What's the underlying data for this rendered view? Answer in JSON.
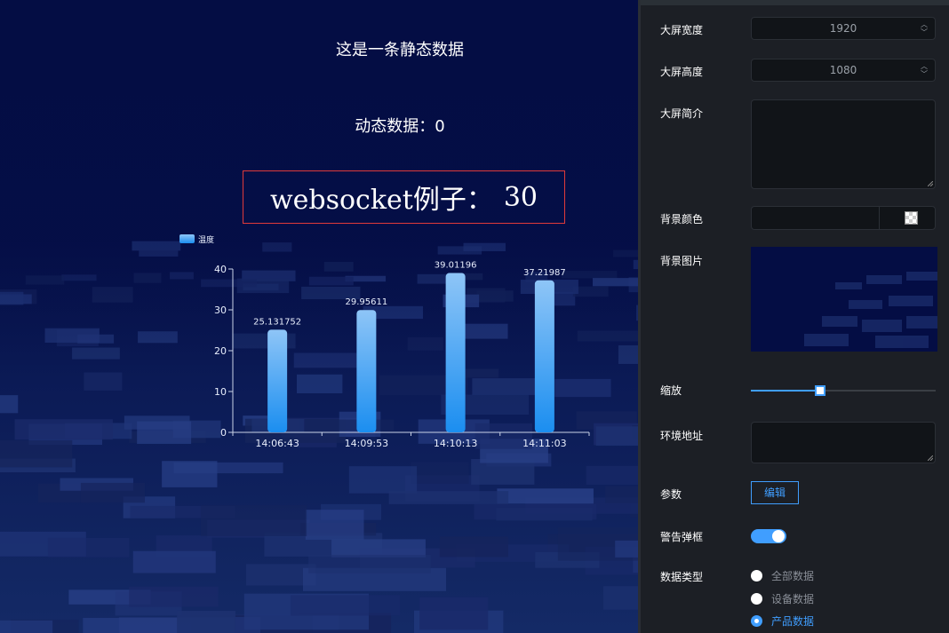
{
  "canvas": {
    "static_text": "这是一条静态数据",
    "dynamic_label": "动态数据：",
    "dynamic_value": "0",
    "ws_label": "websocket例子：",
    "ws_value": "30"
  },
  "chart_data": {
    "type": "bar",
    "legend": [
      "温度"
    ],
    "categories": [
      "14:06:43",
      "14:09:53",
      "14:10:13",
      "14:11:03"
    ],
    "series": [
      {
        "name": "温度",
        "values": [
          25.131752,
          29.95611,
          39.01196,
          37.21987
        ]
      }
    ],
    "value_labels": [
      "25.131752",
      "29.95611",
      "39.01196",
      "37.21987"
    ],
    "ylim": [
      0,
      40
    ],
    "yticks": [
      0,
      10,
      20,
      30,
      40
    ],
    "colors": {
      "bar_top": "#8ec5f7",
      "bar_bottom": "#1b8ef0",
      "axis": "#c9d2e6",
      "text": "#e8eefc"
    }
  },
  "panel": {
    "width": {
      "label": "大屏宽度",
      "value": "1920"
    },
    "height": {
      "label": "大屏高度",
      "value": "1080"
    },
    "intro": {
      "label": "大屏简介",
      "value": ""
    },
    "bg_color": {
      "label": "背景颜色",
      "value": ""
    },
    "bg_image": {
      "label": "背景图片"
    },
    "scale": {
      "label": "缩放",
      "value_fraction": 0.37
    },
    "env_url": {
      "label": "环境地址",
      "value": ""
    },
    "params": {
      "label": "参数",
      "button": "编辑"
    },
    "alert": {
      "label": "警告弹框",
      "enabled": true
    },
    "data_type": {
      "label": "数据类型",
      "options": [
        {
          "label": "全部数据",
          "selected": false
        },
        {
          "label": "设备数据",
          "selected": false
        },
        {
          "label": "产品数据",
          "selected": true
        }
      ]
    },
    "accent": "#409eff"
  }
}
